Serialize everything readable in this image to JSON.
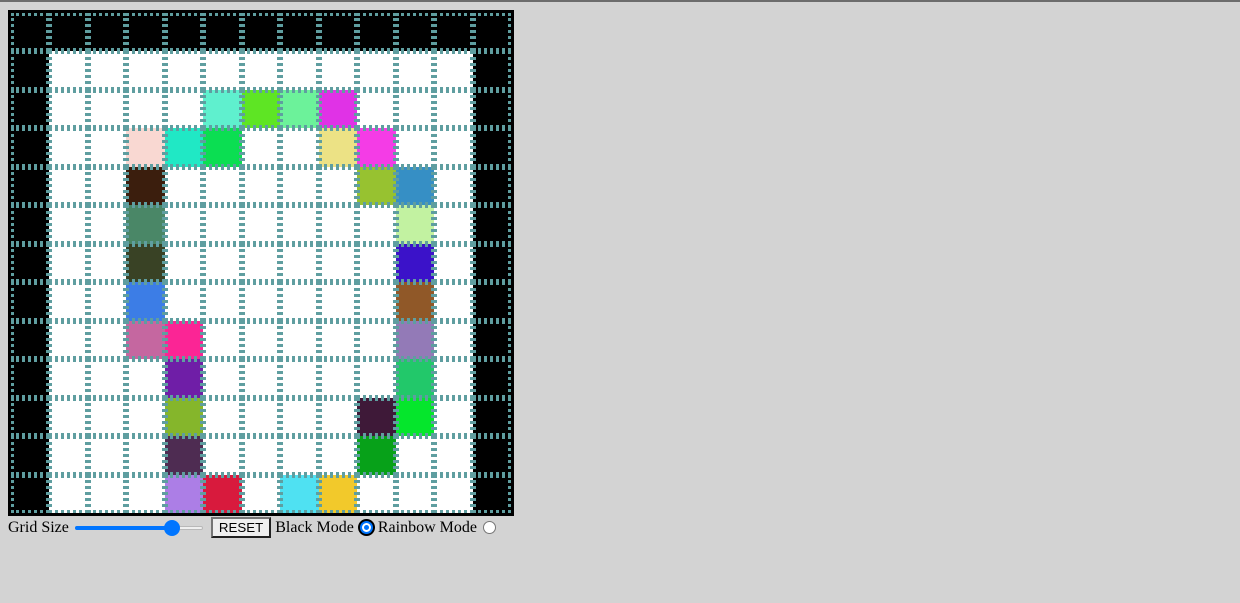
{
  "grid": {
    "size": 13,
    "line_color": "#5f9ea0",
    "default_color": "#ffffff",
    "painted": [
      {
        "r": 0,
        "c": 0,
        "color": "#000000"
      },
      {
        "r": 0,
        "c": 1,
        "color": "#000000"
      },
      {
        "r": 0,
        "c": 2,
        "color": "#000000"
      },
      {
        "r": 0,
        "c": 3,
        "color": "#000000"
      },
      {
        "r": 0,
        "c": 4,
        "color": "#000000"
      },
      {
        "r": 0,
        "c": 5,
        "color": "#000000"
      },
      {
        "r": 0,
        "c": 6,
        "color": "#000000"
      },
      {
        "r": 0,
        "c": 7,
        "color": "#000000"
      },
      {
        "r": 0,
        "c": 8,
        "color": "#000000"
      },
      {
        "r": 0,
        "c": 9,
        "color": "#000000"
      },
      {
        "r": 0,
        "c": 10,
        "color": "#000000"
      },
      {
        "r": 0,
        "c": 11,
        "color": "#000000"
      },
      {
        "r": 0,
        "c": 12,
        "color": "#000000"
      },
      {
        "r": 1,
        "c": 0,
        "color": "#000000"
      },
      {
        "r": 2,
        "c": 0,
        "color": "#000000"
      },
      {
        "r": 3,
        "c": 0,
        "color": "#000000"
      },
      {
        "r": 4,
        "c": 0,
        "color": "#000000"
      },
      {
        "r": 5,
        "c": 0,
        "color": "#000000"
      },
      {
        "r": 6,
        "c": 0,
        "color": "#000000"
      },
      {
        "r": 7,
        "c": 0,
        "color": "#000000"
      },
      {
        "r": 8,
        "c": 0,
        "color": "#000000"
      },
      {
        "r": 9,
        "c": 0,
        "color": "#000000"
      },
      {
        "r": 10,
        "c": 0,
        "color": "#000000"
      },
      {
        "r": 11,
        "c": 0,
        "color": "#000000"
      },
      {
        "r": 12,
        "c": 0,
        "color": "#000000"
      },
      {
        "r": 1,
        "c": 12,
        "color": "#000000"
      },
      {
        "r": 2,
        "c": 12,
        "color": "#000000"
      },
      {
        "r": 3,
        "c": 12,
        "color": "#000000"
      },
      {
        "r": 4,
        "c": 12,
        "color": "#000000"
      },
      {
        "r": 5,
        "c": 12,
        "color": "#000000"
      },
      {
        "r": 6,
        "c": 12,
        "color": "#000000"
      },
      {
        "r": 7,
        "c": 12,
        "color": "#000000"
      },
      {
        "r": 8,
        "c": 12,
        "color": "#000000"
      },
      {
        "r": 9,
        "c": 12,
        "color": "#000000"
      },
      {
        "r": 10,
        "c": 12,
        "color": "#000000"
      },
      {
        "r": 11,
        "c": 12,
        "color": "#000000"
      },
      {
        "r": 12,
        "c": 12,
        "color": "#000000"
      },
      {
        "r": 2,
        "c": 5,
        "color": "#5ff0ce"
      },
      {
        "r": 2,
        "c": 6,
        "color": "#5ee524"
      },
      {
        "r": 2,
        "c": 7,
        "color": "#6cf29a"
      },
      {
        "r": 2,
        "c": 8,
        "color": "#e032e6"
      },
      {
        "r": 3,
        "c": 3,
        "color": "#f9d8d2"
      },
      {
        "r": 3,
        "c": 4,
        "color": "#20e8c5"
      },
      {
        "r": 3,
        "c": 5,
        "color": "#0bde52"
      },
      {
        "r": 3,
        "c": 8,
        "color": "#ece285"
      },
      {
        "r": 3,
        "c": 9,
        "color": "#f43ce6"
      },
      {
        "r": 4,
        "c": 3,
        "color": "#3b1e0d"
      },
      {
        "r": 4,
        "c": 9,
        "color": "#97c230"
      },
      {
        "r": 4,
        "c": 10,
        "color": "#368fc5"
      },
      {
        "r": 5,
        "c": 3,
        "color": "#4a8767"
      },
      {
        "r": 5,
        "c": 10,
        "color": "#c2f2a1"
      },
      {
        "r": 6,
        "c": 3,
        "color": "#394225"
      },
      {
        "r": 6,
        "c": 10,
        "color": "#3b12c9"
      },
      {
        "r": 7,
        "c": 3,
        "color": "#3c7de6"
      },
      {
        "r": 7,
        "c": 10,
        "color": "#905828"
      },
      {
        "r": 8,
        "c": 3,
        "color": "#c567a0"
      },
      {
        "r": 8,
        "c": 4,
        "color": "#fb2595"
      },
      {
        "r": 8,
        "c": 10,
        "color": "#937ab7"
      },
      {
        "r": 9,
        "c": 4,
        "color": "#6f1ea7"
      },
      {
        "r": 9,
        "c": 10,
        "color": "#22c86a"
      },
      {
        "r": 10,
        "c": 4,
        "color": "#85b62b"
      },
      {
        "r": 10,
        "c": 9,
        "color": "#3e1938"
      },
      {
        "r": 10,
        "c": 10,
        "color": "#05e62c"
      },
      {
        "r": 11,
        "c": 4,
        "color": "#4e2c52"
      },
      {
        "r": 11,
        "c": 9,
        "color": "#07a119"
      },
      {
        "r": 12,
        "c": 4,
        "color": "#ac7ee6"
      },
      {
        "r": 12,
        "c": 5,
        "color": "#d81a3d"
      },
      {
        "r": 12,
        "c": 7,
        "color": "#4fe1f2"
      },
      {
        "r": 12,
        "c": 8,
        "color": "#f2c92b"
      }
    ]
  },
  "controls": {
    "grid_size_label": "Grid Size",
    "grid_size_slider": {
      "value": 13,
      "min": 1,
      "max": 20,
      "fraction": 0.76
    },
    "reset_label": "RESET",
    "black_mode_label": "Black Mode",
    "black_mode_checked": true,
    "rainbow_mode_label": "Rainbow Mode",
    "rainbow_mode_checked": false,
    "accent_color": "#0075ff"
  }
}
